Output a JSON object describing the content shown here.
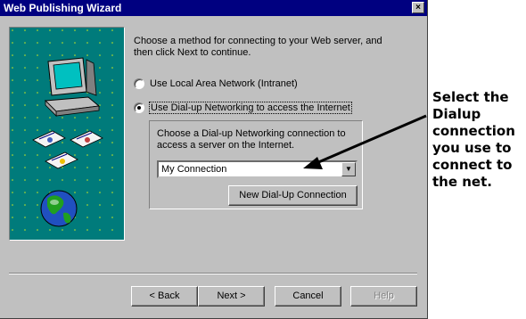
{
  "window": {
    "title": "Web Publishing Wizard",
    "close_glyph": "×"
  },
  "intro": "Choose a method for connecting to your Web server, and then click Next to continue.",
  "options": [
    {
      "label": "Use Local Area Network (Intranet)",
      "checked": false
    },
    {
      "label": "Use Dial-up Networking to access the Internet",
      "checked": true
    }
  ],
  "dialup": {
    "prompt": "Choose a Dial-up Networking connection to access a server on the Internet.",
    "selected_connection": "My Connection",
    "new_button": "New Dial-Up Connection"
  },
  "buttons": {
    "back": "< Back",
    "next": "Next >",
    "cancel": "Cancel",
    "help": "Help"
  },
  "annotation": "Select the Dialup connection you use to connect to the net.",
  "colors": {
    "titlebar": "#000080",
    "panel": "#007b7b",
    "face": "#c0c0c0"
  },
  "icons": [
    "computer-icon",
    "documents-icon",
    "globe-icon",
    "arrow-pointer"
  ]
}
